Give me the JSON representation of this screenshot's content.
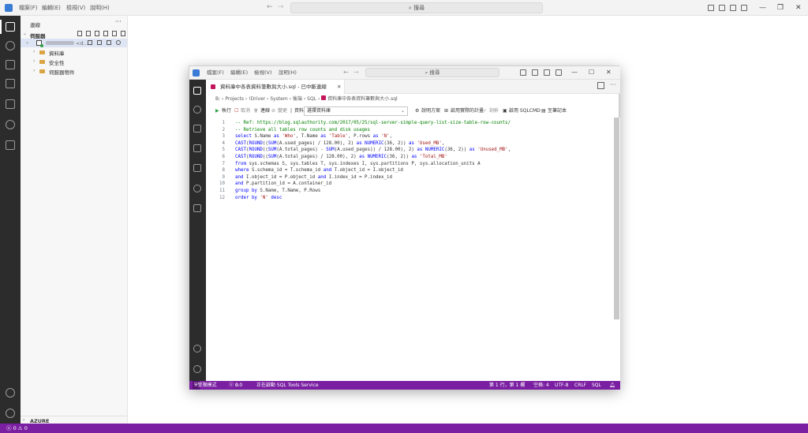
{
  "outer": {
    "menu": [
      "檔案(F)",
      "編輯(E)",
      "檢視(V)",
      "說明(H)"
    ],
    "search_placeholder": "搜尋",
    "sidebar": {
      "title": "連線",
      "more": "···",
      "group": "伺服器",
      "server_suffix": "<d...",
      "items": [
        "資料庫",
        "安全性",
        "伺服器物件"
      ],
      "footer_section": "AZURE"
    },
    "status": {
      "errors": "0",
      "warnings": "0"
    }
  },
  "inner": {
    "menu": [
      "檔案(F)",
      "編輯(E)",
      "檢視(V)",
      "說明(H)"
    ],
    "search_placeholder": "搜尋",
    "tab_title": "資料庫中各表資料筆數與大小.sql - 已中斷連線",
    "breadcrumb": [
      "B:",
      "Projects",
      "!Driver",
      "System",
      "後端",
      "SQL",
      "資料庫中各表資料筆數與大小.sql"
    ],
    "toolbar": {
      "run": "執行",
      "cancel": "取消",
      "connect": "連線",
      "change": "變更",
      "db_label": "資料庫:",
      "db_value": "選擇資料庫",
      "plan": "說明方案",
      "enable_actual_plan": "啟用實際的計畫",
      "parse": "剖析",
      "enable_sqlcmd": "啟用 SQLCMD",
      "notebook": "至筆記本"
    },
    "code_lines": [
      [
        {
          "t": "-- Ref: https://blog.sqlauthority.com/2017/05/25/sql-server-simple-query-list-size-table-row-counts/",
          "c": "cm"
        }
      ],
      [
        {
          "t": "-- Retrieve all tables row counts and disk usages",
          "c": "cm"
        }
      ],
      [
        {
          "t": "select ",
          "c": "kw"
        },
        {
          "t": "S.Name ",
          "c": ""
        },
        {
          "t": "as ",
          "c": "kw"
        },
        {
          "t": "'Who'",
          "c": "st"
        },
        {
          "t": ", T.Name ",
          "c": ""
        },
        {
          "t": "as ",
          "c": "kw"
        },
        {
          "t": "'Table'",
          "c": "st"
        },
        {
          "t": ", P.rows ",
          "c": ""
        },
        {
          "t": "as ",
          "c": "kw"
        },
        {
          "t": "'N'",
          "c": "st"
        },
        {
          "t": ",",
          "c": ""
        }
      ],
      [
        {
          "t": "CAST",
          "c": "kw"
        },
        {
          "t": "(",
          "c": ""
        },
        {
          "t": "ROUND",
          "c": "kw"
        },
        {
          "t": "((",
          "c": ""
        },
        {
          "t": "SUM",
          "c": "kw"
        },
        {
          "t": "(A.used_pages) / 128.00), 2) ",
          "c": ""
        },
        {
          "t": "as ",
          "c": "kw"
        },
        {
          "t": "NUMERIC",
          "c": "kw"
        },
        {
          "t": "(36, 2)) ",
          "c": ""
        },
        {
          "t": "as ",
          "c": "kw"
        },
        {
          "t": "'Used_MB'",
          "c": "st"
        },
        {
          "t": ",",
          "c": ""
        }
      ],
      [
        {
          "t": "CAST",
          "c": "kw"
        },
        {
          "t": "(",
          "c": ""
        },
        {
          "t": "ROUND",
          "c": "kw"
        },
        {
          "t": "((",
          "c": ""
        },
        {
          "t": "SUM",
          "c": "kw"
        },
        {
          "t": "(A.total_pages) - ",
          "c": ""
        },
        {
          "t": "SUM",
          "c": "kw"
        },
        {
          "t": "(A.used_pages)) / 128.00), 2) ",
          "c": ""
        },
        {
          "t": "as ",
          "c": "kw"
        },
        {
          "t": "NUMERIC",
          "c": "kw"
        },
        {
          "t": "(36, 2)) ",
          "c": ""
        },
        {
          "t": "as ",
          "c": "kw"
        },
        {
          "t": "'Unused_MB'",
          "c": "st"
        },
        {
          "t": ",",
          "c": ""
        }
      ],
      [
        {
          "t": "CAST",
          "c": "kw"
        },
        {
          "t": "(",
          "c": ""
        },
        {
          "t": "ROUND",
          "c": "kw"
        },
        {
          "t": "((",
          "c": ""
        },
        {
          "t": "SUM",
          "c": "kw"
        },
        {
          "t": "(A.total_pages) / 128.00), 2) ",
          "c": ""
        },
        {
          "t": "as ",
          "c": "kw"
        },
        {
          "t": "NUMERIC",
          "c": "kw"
        },
        {
          "t": "(36, 2)) ",
          "c": ""
        },
        {
          "t": "as ",
          "c": "kw"
        },
        {
          "t": "'Total_MB'",
          "c": "st"
        }
      ],
      [
        {
          "t": "from ",
          "c": "kw"
        },
        {
          "t": "sys.schemas S, sys.tables T, sys.indexes I, sys.partitions P, sys.allocation_units A",
          "c": ""
        }
      ],
      [
        {
          "t": "where ",
          "c": "kw"
        },
        {
          "t": "S.schema_id = T.schema_id ",
          "c": ""
        },
        {
          "t": "and ",
          "c": "kw"
        },
        {
          "t": "T.object_id = I.object_id",
          "c": ""
        }
      ],
      [
        {
          "t": "and ",
          "c": "kw"
        },
        {
          "t": "I.object_id = P.object_id ",
          "c": ""
        },
        {
          "t": "and ",
          "c": "kw"
        },
        {
          "t": "I.index_id = P.index_id",
          "c": ""
        }
      ],
      [
        {
          "t": "and ",
          "c": "kw"
        },
        {
          "t": "P.partition_id = A.container_id",
          "c": ""
        }
      ],
      [
        {
          "t": "group by ",
          "c": "kw"
        },
        {
          "t": "S.Name, T.Name, P.Rows",
          "c": ""
        }
      ],
      [
        {
          "t": "order by ",
          "c": "kw"
        },
        {
          "t": "'N' ",
          "c": "st"
        },
        {
          "t": "desc",
          "c": "kw"
        }
      ]
    ],
    "status": {
      "safe_mode": "受限模式",
      "errors": "0",
      "warnings": "0",
      "service": "正在啟動 SQL Tools Service",
      "position": "第 1 行，第 1 欄",
      "spaces": "空格: 4",
      "encoding": "UTF-8",
      "eol": "CRLF",
      "language": "SQL"
    }
  },
  "colors": {
    "accent": "#7b1fa2",
    "activity_bar": "#2c2c2c"
  }
}
